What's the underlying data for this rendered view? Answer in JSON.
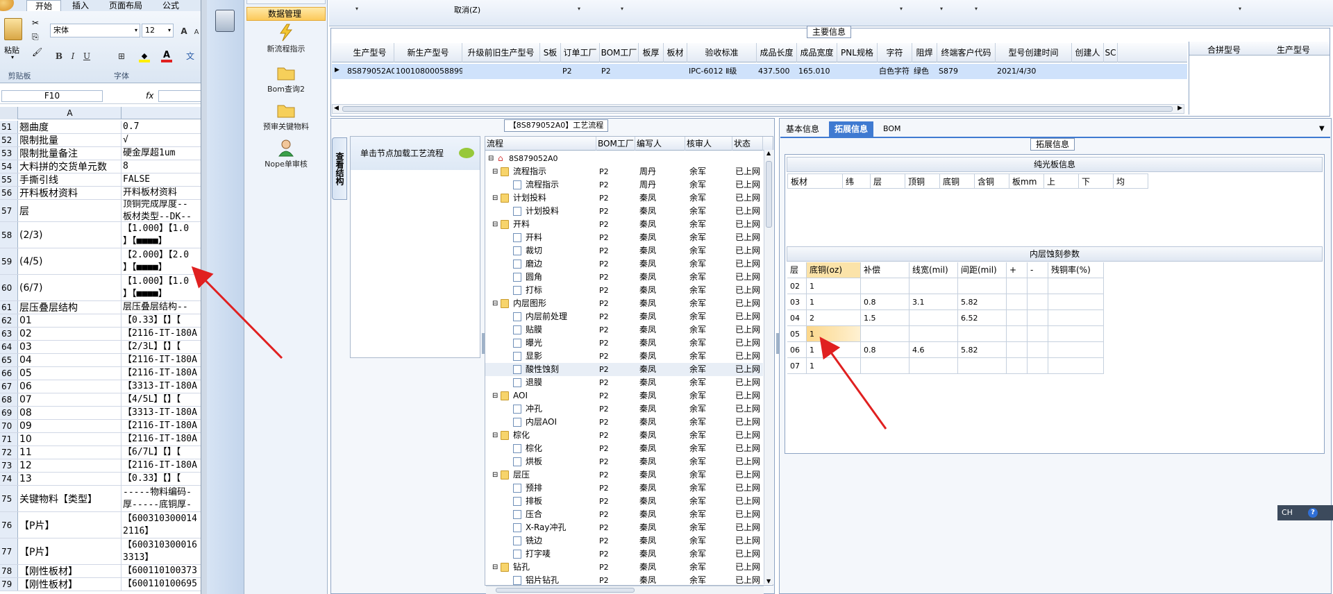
{
  "excel": {
    "tabs": [
      "开始",
      "插入",
      "页面布局",
      "公式"
    ],
    "font_name": "宋体",
    "font_size": "12",
    "paste_label": "粘贴",
    "clipboard_label": "剪贴板",
    "font_group_label": "字体",
    "cell_ref": "F10",
    "fx_label": "fx",
    "col_a": "A",
    "rows": [
      {
        "n": "51",
        "a": "翘曲度",
        "b": "0.7"
      },
      {
        "n": "52",
        "a": "限制批量",
        "b": "√"
      },
      {
        "n": "53",
        "a": "限制批量备注",
        "b": "硬金厚超1um"
      },
      {
        "n": "54",
        "a": "大料拼的交货单元数",
        "b": "8"
      },
      {
        "n": "55",
        "a": "手撕引线",
        "b": "FALSE"
      },
      {
        "n": "56",
        "a": "开料板材资料",
        "b": "开料板材资料"
      },
      {
        "n": "57",
        "a": "层",
        "b": "顶铜完成厚度--\n板材类型--DK--"
      },
      {
        "n": "58",
        "a": "(2/3)",
        "b": "【1.000】【1.0\n】【■■■■】"
      },
      {
        "n": "59",
        "a": "(4/5)",
        "b": "【2.000】【2.0\n】【■■■■】"
      },
      {
        "n": "60",
        "a": "(6/7)",
        "b": "【1.000】【1.0\n】【■■■■】"
      },
      {
        "n": "61",
        "a": "层压叠层结构",
        "b": "层压叠层结构--"
      },
      {
        "n": "62",
        "a": "01",
        "b": "【0.33】【】【"
      },
      {
        "n": "63",
        "a": "02",
        "b": "【2116-IT-180A"
      },
      {
        "n": "64",
        "a": "03",
        "b": "【2/3L】【】【"
      },
      {
        "n": "65",
        "a": "04",
        "b": "【2116-IT-180A"
      },
      {
        "n": "66",
        "a": "05",
        "b": "【2116-IT-180A"
      },
      {
        "n": "67",
        "a": "06",
        "b": "【3313-IT-180A"
      },
      {
        "n": "68",
        "a": "07",
        "b": "【4/5L】【】【"
      },
      {
        "n": "69",
        "a": "08",
        "b": "【3313-IT-180A"
      },
      {
        "n": "70",
        "a": "09",
        "b": "【2116-IT-180A"
      },
      {
        "n": "71",
        "a": "10",
        "b": "【2116-IT-180A"
      },
      {
        "n": "72",
        "a": "11",
        "b": "【6/7L】【】【"
      },
      {
        "n": "73",
        "a": "12",
        "b": "【2116-IT-180A"
      },
      {
        "n": "74",
        "a": "13",
        "b": "【0.33】【】【"
      },
      {
        "n": "75",
        "a": "关键物料【类型】",
        "b": "-----物料编码-\n厚-----底铜厚-"
      },
      {
        "n": "76",
        "a": "【P片】",
        "b": "【600310300014\n2116】"
      },
      {
        "n": "77",
        "a": "【P片】",
        "b": "【600310300016\n3313】"
      },
      {
        "n": "78",
        "a": "【刚性板材】",
        "b": "【600110100373"
      },
      {
        "n": "79",
        "a": "【刚性板材】",
        "b": "【600110100695"
      }
    ]
  },
  "nav": {
    "selected": "数据管理",
    "items": [
      "新流程指示",
      "Bom查询2",
      "预审关键物料",
      "Nope单审核"
    ]
  },
  "toolbar": {
    "cancel_label": "取消(Z)"
  },
  "main_info": {
    "title": "主要信息",
    "columns": [
      "生产型号",
      "新生产型号",
      "升级前旧生产型号",
      "S板",
      "订单工厂",
      "BOM工厂",
      "板厚",
      "板材",
      "验收标准",
      "成品长度",
      "成品宽度",
      "PNL规格",
      "字符",
      "阻焊",
      "终端客户代码",
      "型号创建时间",
      "创建人",
      "SC"
    ],
    "row": [
      "8S879052A0",
      "10010800058899",
      "",
      "",
      "P2",
      "P2",
      "",
      "",
      "IPC-6012 Ⅱ级",
      "437.500",
      "165.010",
      "",
      "白色字符",
      "绿色",
      "S879",
      "2021/4/30",
      "",
      ""
    ],
    "side_columns": [
      "合拼型号",
      "生产型号"
    ]
  },
  "process": {
    "title": "【8S879052A0】工艺流程",
    "vtab_label": "查看结构",
    "load_hint": "单击节点加载工艺流程",
    "columns": [
      "流程",
      "BOM工厂",
      "编写人",
      "核审人",
      "状态"
    ],
    "root": "8S879052A0",
    "rows": [
      {
        "lvl": 1,
        "t": "f",
        "name": "流程指示",
        "bom": "P2",
        "writer": "周丹",
        "rev": "余军",
        "st": "已上网"
      },
      {
        "lvl": 2,
        "t": "d",
        "name": "流程指示",
        "bom": "P2",
        "writer": "周丹",
        "rev": "余军",
        "st": "已上网"
      },
      {
        "lvl": 1,
        "t": "f",
        "name": "计划投料",
        "bom": "P2",
        "writer": "秦凤",
        "rev": "余军",
        "st": "已上网"
      },
      {
        "lvl": 2,
        "t": "d",
        "name": "计划投料",
        "bom": "P2",
        "writer": "秦凤",
        "rev": "余军",
        "st": "已上网"
      },
      {
        "lvl": 1,
        "t": "f",
        "name": "开料",
        "bom": "P2",
        "writer": "秦凤",
        "rev": "余军",
        "st": "已上网"
      },
      {
        "lvl": 2,
        "t": "d",
        "name": "开料",
        "bom": "P2",
        "writer": "秦凤",
        "rev": "余军",
        "st": "已上网"
      },
      {
        "lvl": 2,
        "t": "d",
        "name": "裁切",
        "bom": "P2",
        "writer": "秦凤",
        "rev": "余军",
        "st": "已上网"
      },
      {
        "lvl": 2,
        "t": "d",
        "name": "磨边",
        "bom": "P2",
        "writer": "秦凤",
        "rev": "余军",
        "st": "已上网"
      },
      {
        "lvl": 2,
        "t": "d",
        "name": "圆角",
        "bom": "P2",
        "writer": "秦凤",
        "rev": "余军",
        "st": "已上网"
      },
      {
        "lvl": 2,
        "t": "d",
        "name": "打标",
        "bom": "P2",
        "writer": "秦凤",
        "rev": "余军",
        "st": "已上网"
      },
      {
        "lvl": 1,
        "t": "f",
        "name": "内层图形",
        "bom": "P2",
        "writer": "秦凤",
        "rev": "余军",
        "st": "已上网"
      },
      {
        "lvl": 2,
        "t": "d",
        "name": "内层前处理",
        "bom": "P2",
        "writer": "秦凤",
        "rev": "余军",
        "st": "已上网"
      },
      {
        "lvl": 2,
        "t": "d",
        "name": "贴膜",
        "bom": "P2",
        "writer": "秦凤",
        "rev": "余军",
        "st": "已上网"
      },
      {
        "lvl": 2,
        "t": "d",
        "name": "曝光",
        "bom": "P2",
        "writer": "秦凤",
        "rev": "余军",
        "st": "已上网"
      },
      {
        "lvl": 2,
        "t": "d",
        "name": "显影",
        "bom": "P2",
        "writer": "秦凤",
        "rev": "余军",
        "st": "已上网"
      },
      {
        "lvl": 2,
        "t": "d",
        "name": "酸性蚀刻",
        "bom": "P2",
        "writer": "秦凤",
        "rev": "余军",
        "st": "已上网",
        "sel": true
      },
      {
        "lvl": 2,
        "t": "d",
        "name": "退膜",
        "bom": "P2",
        "writer": "秦凤",
        "rev": "余军",
        "st": "已上网"
      },
      {
        "lvl": 1,
        "t": "f",
        "name": "AOI",
        "bom": "P2",
        "writer": "秦凤",
        "rev": "余军",
        "st": "已上网"
      },
      {
        "lvl": 2,
        "t": "d",
        "name": "冲孔",
        "bom": "P2",
        "writer": "秦凤",
        "rev": "余军",
        "st": "已上网"
      },
      {
        "lvl": 2,
        "t": "d",
        "name": "内层AOI",
        "bom": "P2",
        "writer": "秦凤",
        "rev": "余军",
        "st": "已上网"
      },
      {
        "lvl": 1,
        "t": "f",
        "name": "棕化",
        "bom": "P2",
        "writer": "秦凤",
        "rev": "余军",
        "st": "已上网"
      },
      {
        "lvl": 2,
        "t": "d",
        "name": "棕化",
        "bom": "P2",
        "writer": "秦凤",
        "rev": "余军",
        "st": "已上网"
      },
      {
        "lvl": 2,
        "t": "d",
        "name": "烘板",
        "bom": "P2",
        "writer": "秦凤",
        "rev": "余军",
        "st": "已上网"
      },
      {
        "lvl": 1,
        "t": "f",
        "name": "层压",
        "bom": "P2",
        "writer": "秦凤",
        "rev": "余军",
        "st": "已上网"
      },
      {
        "lvl": 2,
        "t": "d",
        "name": "预排",
        "bom": "P2",
        "writer": "秦凤",
        "rev": "余军",
        "st": "已上网"
      },
      {
        "lvl": 2,
        "t": "d",
        "name": "排板",
        "bom": "P2",
        "writer": "秦凤",
        "rev": "余军",
        "st": "已上网"
      },
      {
        "lvl": 2,
        "t": "d",
        "name": "压合",
        "bom": "P2",
        "writer": "秦凤",
        "rev": "余军",
        "st": "已上网"
      },
      {
        "lvl": 2,
        "t": "d",
        "name": "X-Ray冲孔",
        "bom": "P2",
        "writer": "秦凤",
        "rev": "余军",
        "st": "已上网"
      },
      {
        "lvl": 2,
        "t": "d",
        "name": "铣边",
        "bom": "P2",
        "writer": "秦凤",
        "rev": "余军",
        "st": "已上网"
      },
      {
        "lvl": 2,
        "t": "d",
        "name": "打字唛",
        "bom": "P2",
        "writer": "秦凤",
        "rev": "余军",
        "st": "已上网"
      },
      {
        "lvl": 1,
        "t": "f",
        "name": "钻孔",
        "bom": "P2",
        "writer": "秦凤",
        "rev": "余军",
        "st": "已上网"
      },
      {
        "lvl": 2,
        "t": "d",
        "name": "铝片钻孔",
        "bom": "P2",
        "writer": "秦凤",
        "rev": "余军",
        "st": "已上网"
      }
    ]
  },
  "right": {
    "tabs": [
      "基本信息",
      "拓展信息",
      "BOM"
    ],
    "active_tab": "拓展信息",
    "ext_title": "拓展信息",
    "pure_title": "纯光板信息",
    "pure_cols": [
      "板材",
      "纬",
      "层",
      "顶铜",
      "底铜",
      "含铜",
      "板mm",
      "上",
      "下",
      "均"
    ],
    "inner_title": "内层蚀刻参数",
    "inner_cols": [
      "层",
      "底铜(oz)",
      "补偿",
      "线宽(mil)",
      "间距(mil)",
      "+",
      "-",
      "残铜率(%)"
    ],
    "inner_rows": [
      [
        "02",
        "1",
        "",
        "",
        "",
        "",
        "",
        ""
      ],
      [
        "03",
        "1",
        "0.8",
        "3.1",
        "5.82",
        "",
        "",
        ""
      ],
      [
        "04",
        "2",
        "1.5",
        "",
        "6.52",
        "",
        "",
        ""
      ],
      [
        "05",
        "1",
        "",
        "",
        "",
        "",
        "",
        ""
      ],
      [
        "06",
        "1",
        "0.8",
        "4.6",
        "5.82",
        "",
        "",
        ""
      ],
      [
        "07",
        "1",
        "",
        "",
        "",
        "",
        "",
        ""
      ]
    ],
    "selected_row": 3
  },
  "ime": {
    "label": "CH"
  },
  "colors": {
    "accent": "#3f7ad1",
    "arrow": "#e02020",
    "highlight": "#fbe3a9"
  }
}
